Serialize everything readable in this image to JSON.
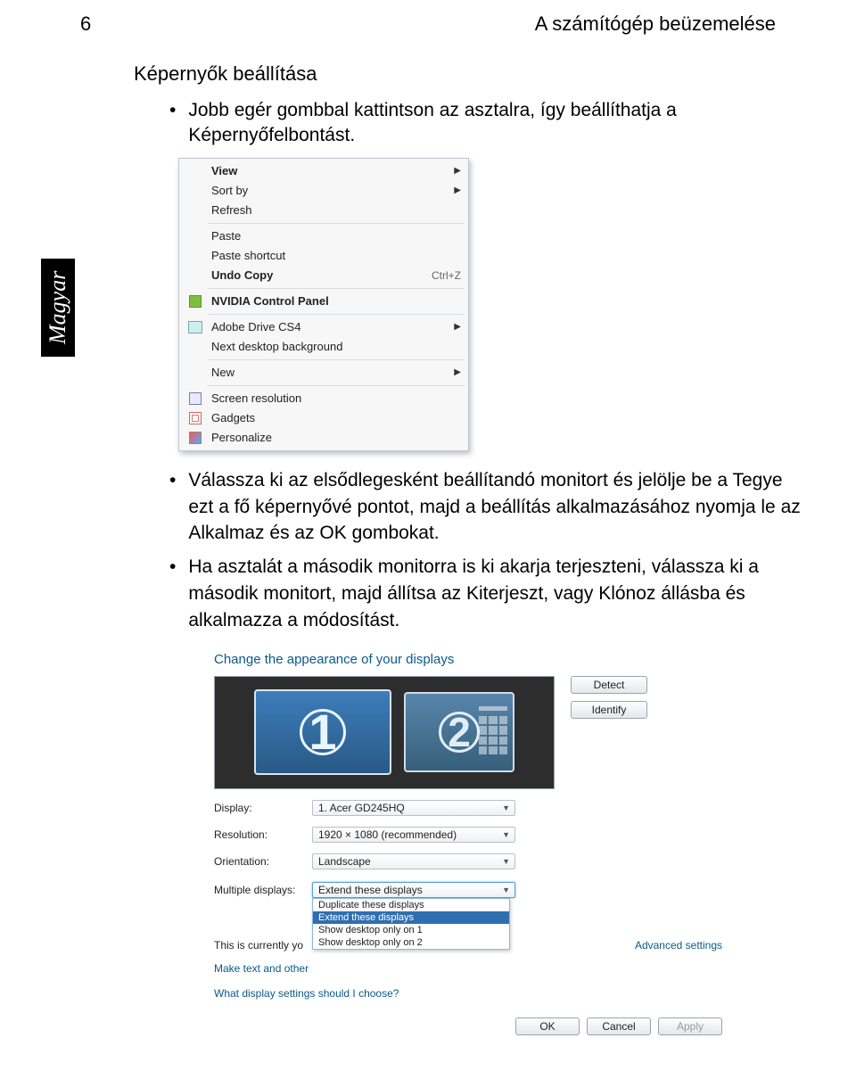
{
  "header": {
    "page_number": "6",
    "chapter_title": "A számítógép beüzemelése"
  },
  "sidebar_label": "Magyar",
  "heading": "Képernyők beállítása",
  "intro_text": "Jobb egér gombbal kattintson az asztalra, így beállíthatja a Képernyőfelbontást.",
  "ctxmenu": {
    "view": "View",
    "sort_by": "Sort by",
    "refresh": "Refresh",
    "paste": "Paste",
    "paste_shortcut": "Paste shortcut",
    "undo_copy": "Undo Copy",
    "undo_shortcut": "Ctrl+Z",
    "nvidia": "NVIDIA Control Panel",
    "adobe": "Adobe Drive CS4",
    "next_bg": "Next desktop background",
    "new": "New",
    "screen_res": "Screen resolution",
    "gadgets": "Gadgets",
    "personalize": "Personalize"
  },
  "bullets": {
    "b1": "Válassza ki az elsődlegesként beállítandó monitort és jelölje be a Tegye ezt a fő képernyővé pontot, majd a beállítás alkalmazásához nyomja le az Alkalmaz és az OK gombokat.",
    "b2": "Ha asztalát a második monitorra is ki akarja terjeszteni, válassza ki a második monitort, majd állítsa az Kiterjeszt, vagy Klónoz állásba és alkalmazza a módosítást."
  },
  "dispanel": {
    "title": "Change the appearance of your displays",
    "detect": "Detect",
    "identify": "Identify",
    "mon1": "1",
    "mon2": "2",
    "display_label": "Display:",
    "display_value": "1. Acer GD245HQ",
    "resolution_label": "Resolution:",
    "resolution_value": "1920 × 1080 (recommended)",
    "orientation_label": "Orientation:",
    "orientation_value": "Landscape",
    "multi_label": "Multiple displays:",
    "multi_value": "Extend these displays",
    "popup_opts": [
      "Duplicate these displays",
      "Extend these displays",
      "Show desktop only on 1",
      "Show desktop only on 2"
    ],
    "currently_text": "This is currently yo",
    "advanced": "Advanced settings",
    "make_text": "Make text and other",
    "question": "What display settings should I choose?",
    "ok": "OK",
    "cancel": "Cancel",
    "apply": "Apply"
  }
}
